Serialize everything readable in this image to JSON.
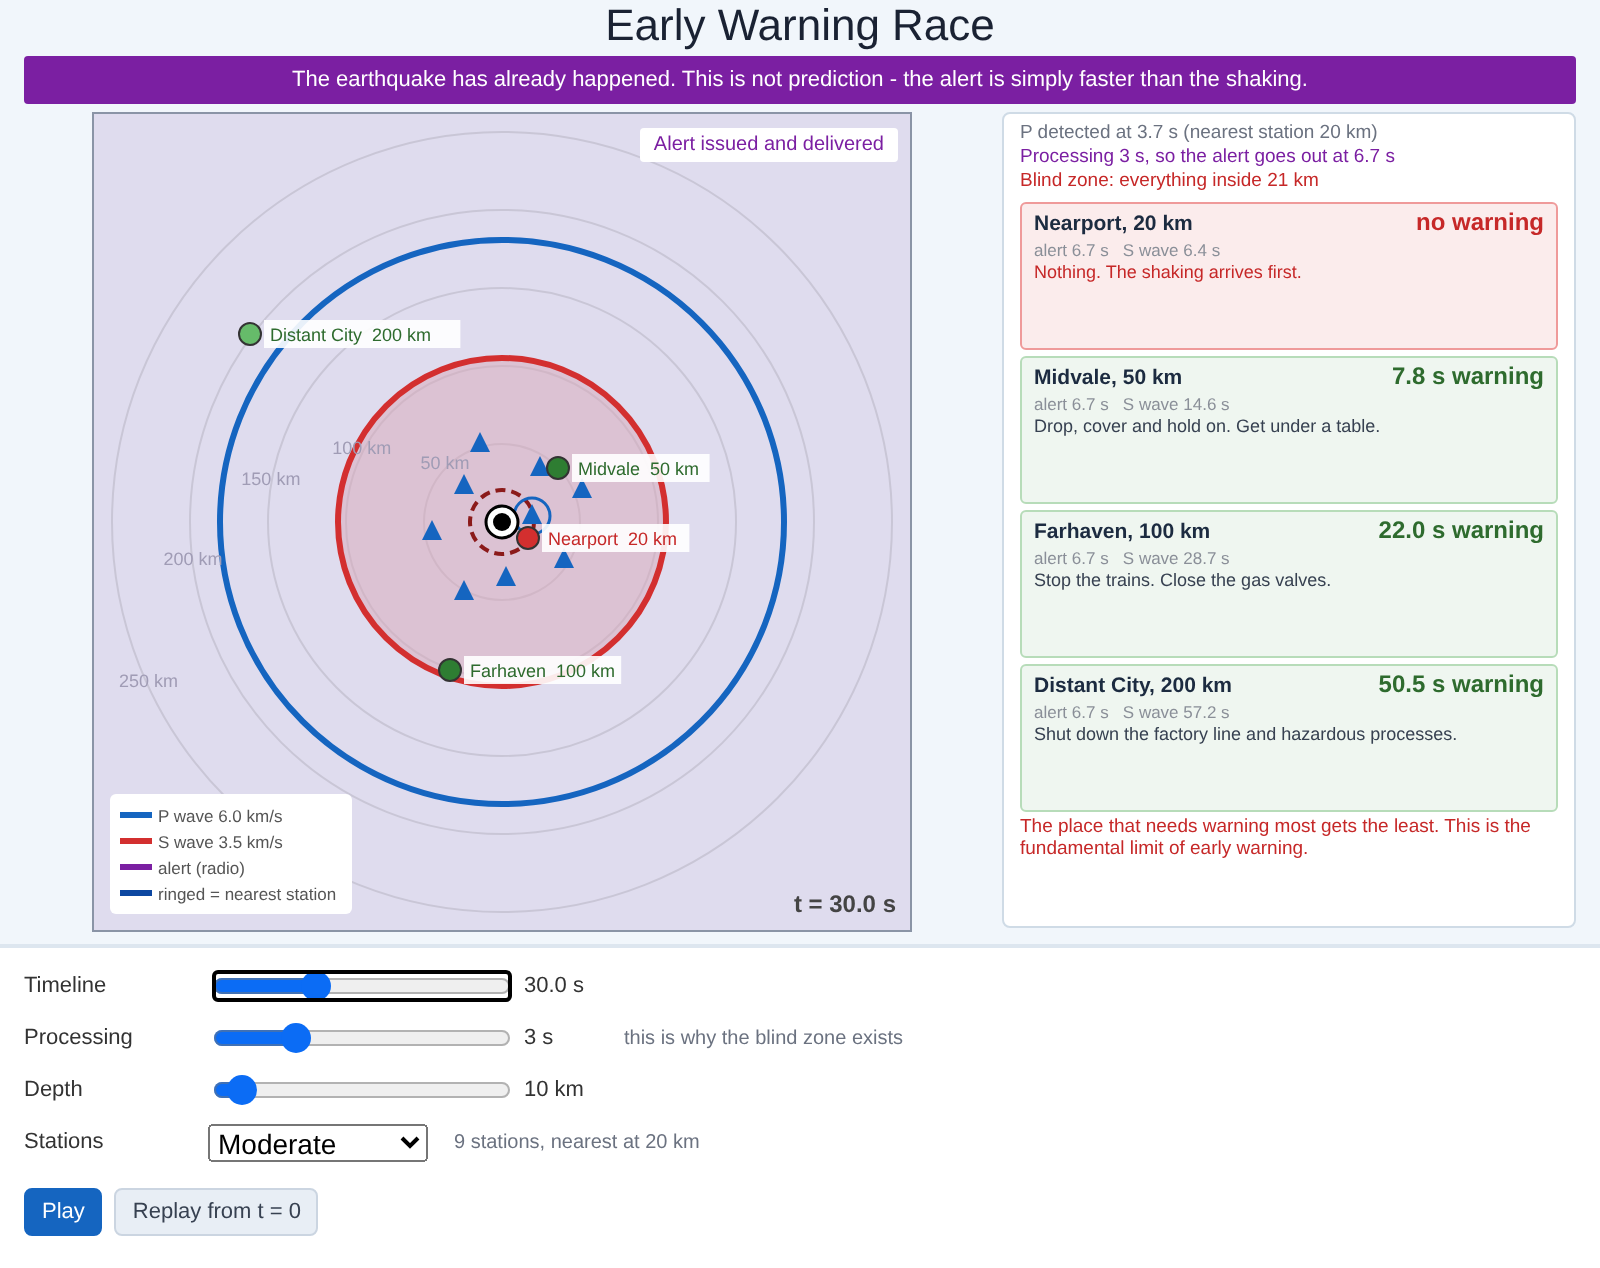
{
  "title": "Early Warning Race",
  "banner": "The earthquake has already happened. This is not prediction - the alert is simply faster than the shaking.",
  "map": {
    "status": "Alert issued and delivered",
    "time": "t = 30.0 s",
    "rings": [
      "50 km",
      "100 km",
      "150 km",
      "200 km",
      "250 km"
    ],
    "cities": [
      {
        "name": "Distant City",
        "distance": "200 km",
        "color": "#66bb6a"
      },
      {
        "name": "Midvale",
        "distance": "50 km",
        "color": "#2e7d32"
      },
      {
        "name": "Nearport",
        "distance": "20 km",
        "color": "#d32f2f"
      },
      {
        "name": "Farhaven",
        "distance": "100 km",
        "color": "#2e7d32"
      }
    ],
    "legend": [
      {
        "label": "P wave 6.0 km/s",
        "color": "#1565c0"
      },
      {
        "label": "S wave 3.5 km/s",
        "color": "#d32f2f"
      },
      {
        "label": "alert (radio)",
        "color": "#7b1fa2"
      },
      {
        "label": "ringed = nearest station",
        "color": "#0d47a1"
      }
    ]
  },
  "summary": [
    {
      "kind": "info",
      "text": "P detected at 3.7 s  (nearest station 20 km)"
    },
    {
      "kind": "alert",
      "text": "Processing 3 s, so the alert goes out at 6.7 s"
    },
    {
      "kind": "blind",
      "text": "Blind zone: everything inside 21 km"
    }
  ],
  "cards": [
    {
      "place": "Nearport, 20 km",
      "warned": false,
      "warning": "no warning",
      "times": "alert 6.7 s   S wave 6.4 s",
      "advice": "Nothing. The shaking arrives first."
    },
    {
      "place": "Midvale, 50 km",
      "warned": true,
      "warning": "7.8 s warning",
      "times": "alert 6.7 s   S wave 14.6 s",
      "advice": "Drop, cover and hold on. Get under a table."
    },
    {
      "place": "Farhaven, 100 km",
      "warned": true,
      "warning": "22.0 s warning",
      "times": "alert 6.7 s   S wave 28.7 s",
      "advice": "Stop the trains. Close the gas valves."
    },
    {
      "place": "Distant City, 200 km",
      "warned": true,
      "warning": "50.5 s warning",
      "times": "alert 6.7 s   S wave 57.2 s",
      "advice": "Shut down the factory line and hazardous processes."
    }
  ],
  "conclusion": "The place that needs warning most gets the least. This is the fundamental limit of early warning.",
  "controls": [
    {
      "kind": "slider",
      "label": "Timeline",
      "level": 0.33,
      "reading": "30.0 s",
      "focused": true
    },
    {
      "kind": "slider",
      "label": "Processing",
      "level": 0.25,
      "reading": "3 s",
      "note": "this is why the blind zone exists",
      "focused": false
    },
    {
      "kind": "slider",
      "label": "Depth",
      "level": 0.05,
      "reading": "10 km",
      "focused": false
    },
    {
      "kind": "select",
      "label": "Stations",
      "value": "Moderate",
      "note": "9 stations, nearest at 20 km"
    }
  ],
  "buttons": [
    {
      "label": "Play",
      "primary": true
    },
    {
      "label": "Replay from t = 0",
      "primary": false
    }
  ]
}
